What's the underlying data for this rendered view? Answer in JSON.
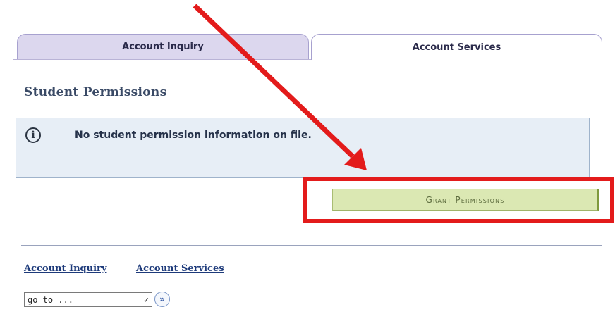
{
  "tabs": [
    {
      "label": "Account Inquiry",
      "active": false
    },
    {
      "label": "Account Services",
      "active": true
    }
  ],
  "section": {
    "title": "Student Permissions"
  },
  "info": {
    "icon": "info-circle-icon",
    "message": "No student permission information on file."
  },
  "actions": {
    "grant_label": "Grant Permissions"
  },
  "footer": {
    "links": [
      "Account Inquiry",
      "Account Services"
    ],
    "goto": {
      "selected": "go to ...",
      "go_icon": "double-chevron-right-icon"
    }
  },
  "annotations": {
    "arrow_color": "#e31b1b",
    "highlight_color": "#e31b1b"
  }
}
